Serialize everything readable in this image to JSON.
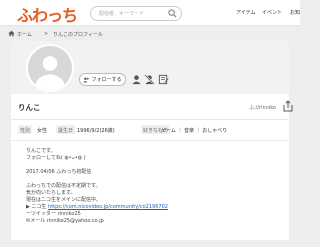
{
  "header": {
    "logo": "ふわっち",
    "search_placeholder": "配信者、キーワード",
    "nav": {
      "item": "アイテム",
      "event": "イベント",
      "more": "お知"
    }
  },
  "breadcrumb": {
    "home": "ホーム",
    "separator": ">",
    "current": "りんこのプロフィール"
  },
  "profile": {
    "follow_label": "フォローする",
    "name": "りんこ",
    "id": "ふ://rinniko"
  },
  "attributes": {
    "gender_label": "性別",
    "gender_value": "女性",
    "birth_label": "誕生日",
    "birth_value": "1996/9/2(26歳)",
    "likes_label": "好きなもの",
    "likes_value": "ゲーム ｜ 音楽 ｜ おしゃべり"
  },
  "bio": {
    "line1": "りんこです。",
    "line2": "フォローしてね( ◍•ᴗ•◍ )",
    "line3": "2017.04/06 ふわっち初配信",
    "line4": "ふわっちでの配信は不定期です。",
    "line5": "気が向いたらします。",
    "line6": "現在はニコ生をメインに配信中。",
    "line7_prefix": "▶ ニコ生 ",
    "line7_link": "https://com.nicovideo.jp/community/co2196702",
    "line8": "ーツイッター rinniko25",
    "line9": "✉メール rinniko25@yahoo.co.jp"
  },
  "colors": {
    "brand": "#ea5a1f",
    "link": "#1a5fc9",
    "background": "#eeeeee"
  }
}
